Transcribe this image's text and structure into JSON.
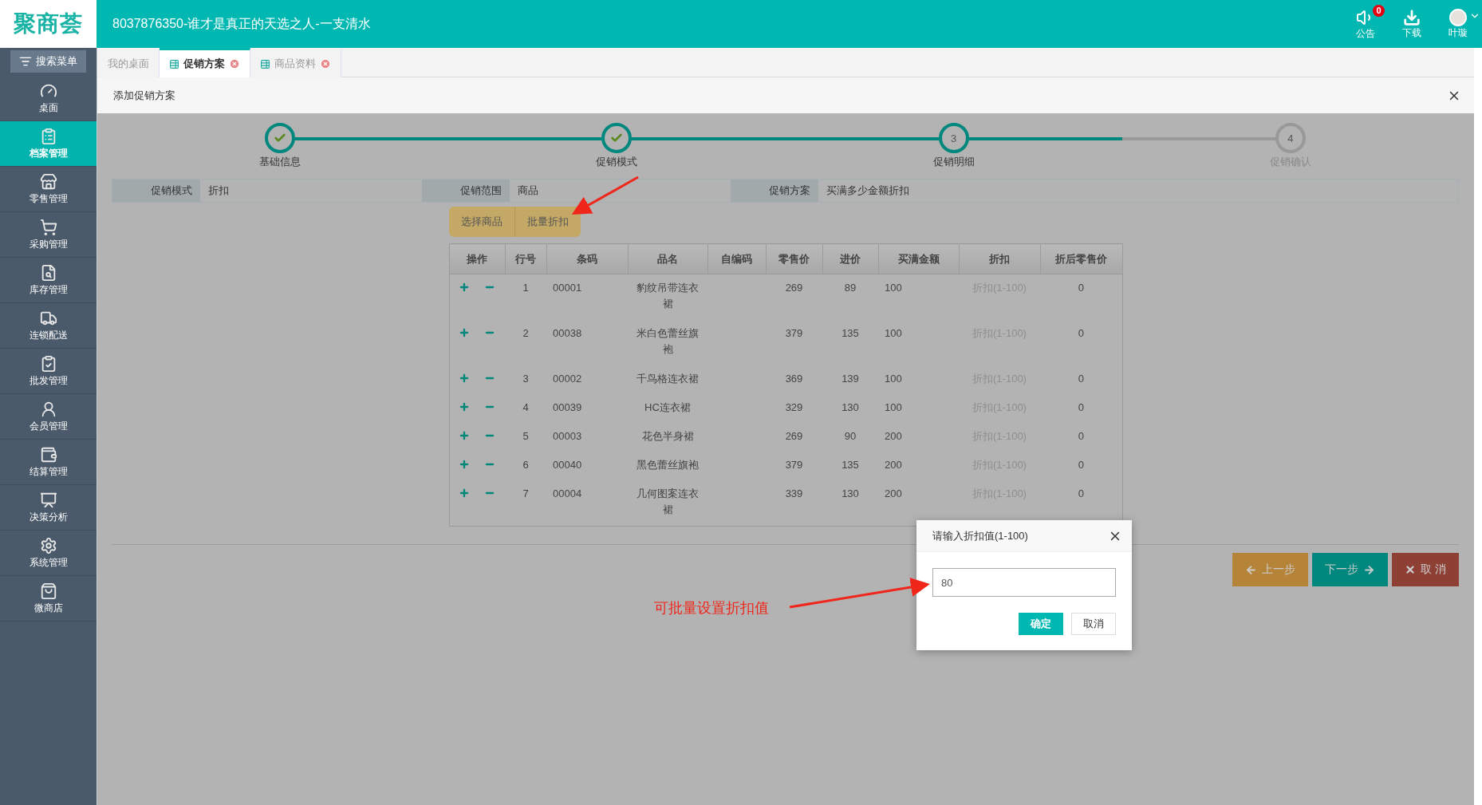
{
  "header": {
    "logo": "聚商荟",
    "title": "8037876350-谁才是真正的天选之人-一支清水",
    "actions": [
      {
        "kind": "notice",
        "label": "公告",
        "badge": "0"
      },
      {
        "kind": "download",
        "label": "下载"
      },
      {
        "kind": "user",
        "label": "叶璇"
      }
    ]
  },
  "sidebar": {
    "search": "搜索菜单",
    "items": [
      {
        "label": "桌面",
        "selected": false
      },
      {
        "label": "档案管理",
        "selected": true
      },
      {
        "label": "零售管理",
        "selected": false
      },
      {
        "label": "采购管理",
        "selected": false
      },
      {
        "label": "库存管理",
        "selected": false
      },
      {
        "label": "连锁配送",
        "selected": false
      },
      {
        "label": "批发管理",
        "selected": false
      },
      {
        "label": "会员管理",
        "selected": false
      },
      {
        "label": "结算管理",
        "selected": false
      },
      {
        "label": "决策分析",
        "selected": false
      },
      {
        "label": "系统管理",
        "selected": false
      },
      {
        "label": "微商店",
        "selected": false
      }
    ]
  },
  "tabs": [
    {
      "label": "我的桌面",
      "selected": false,
      "closable": false
    },
    {
      "label": "促销方案",
      "selected": true,
      "closable": true
    },
    {
      "label": "商品资料",
      "selected": false,
      "closable": true
    }
  ],
  "panel": {
    "title": "添加促销方案",
    "steps": [
      {
        "label": "基础信息",
        "kind": "done"
      },
      {
        "label": "促销模式",
        "kind": "done"
      },
      {
        "number": "3",
        "label": "促销明细",
        "kind": "current"
      },
      {
        "number": "4",
        "label": "促销确认",
        "kind": "pending"
      }
    ],
    "info": [
      {
        "label": "促销模式",
        "value": "折扣"
      },
      {
        "label": "促销范围",
        "value": "商品"
      },
      {
        "label": "促销方案",
        "value": "买满多少金额折扣"
      }
    ],
    "toolbar": [
      "选择商品",
      "批量折扣"
    ],
    "table": {
      "columns": [
        "操作",
        "行号",
        "条码",
        "品名",
        "自编码",
        "零售价",
        "进价",
        "买满金额",
        "折扣",
        "折后零售价"
      ],
      "rows": [
        {
          "line": "1",
          "barcode": "00001",
          "name": "豹纹吊带连衣裙",
          "retail": "269",
          "cost": "89",
          "threshold": "100",
          "discount_placeholder": "折扣(1-100)",
          "final": "0"
        },
        {
          "line": "2",
          "barcode": "00038",
          "name": "米白色蕾丝旗袍",
          "retail": "379",
          "cost": "135",
          "threshold": "100",
          "discount_placeholder": "折扣(1-100)",
          "final": "0"
        },
        {
          "line": "3",
          "barcode": "00002",
          "name": "千鸟格连衣裙",
          "retail": "369",
          "cost": "139",
          "threshold": "100",
          "discount_placeholder": "折扣(1-100)",
          "final": "0"
        },
        {
          "line": "4",
          "barcode": "00039",
          "name": "HC连衣裙",
          "retail": "329",
          "cost": "130",
          "threshold": "100",
          "discount_placeholder": "折扣(1-100)",
          "final": "0"
        },
        {
          "line": "5",
          "barcode": "00003",
          "name": "花色半身裙",
          "retail": "269",
          "cost": "90",
          "threshold": "200",
          "discount_placeholder": "折扣(1-100)",
          "final": "0"
        },
        {
          "line": "6",
          "barcode": "00040",
          "name": "黑色蕾丝旗袍",
          "retail": "379",
          "cost": "135",
          "threshold": "200",
          "discount_placeholder": "折扣(1-100)",
          "final": "0"
        },
        {
          "line": "7",
          "barcode": "00004",
          "name": "几何图案连衣裙",
          "retail": "339",
          "cost": "130",
          "threshold": "200",
          "discount_placeholder": "折扣(1-100)",
          "final": "0"
        }
      ]
    },
    "footer_buttons": [
      {
        "kind": "prev",
        "label": "上一步"
      },
      {
        "kind": "next",
        "label": "下一步"
      },
      {
        "kind": "cancel",
        "label": "取 消"
      }
    ]
  },
  "dialog": {
    "title": "请输入折扣值(1-100)",
    "value": "80",
    "buttons": [
      {
        "kind": "primary",
        "label": "确定"
      },
      {
        "kind": "default",
        "label": "取消"
      }
    ]
  },
  "annotation": {
    "text": "可批量设置折扣值"
  }
}
